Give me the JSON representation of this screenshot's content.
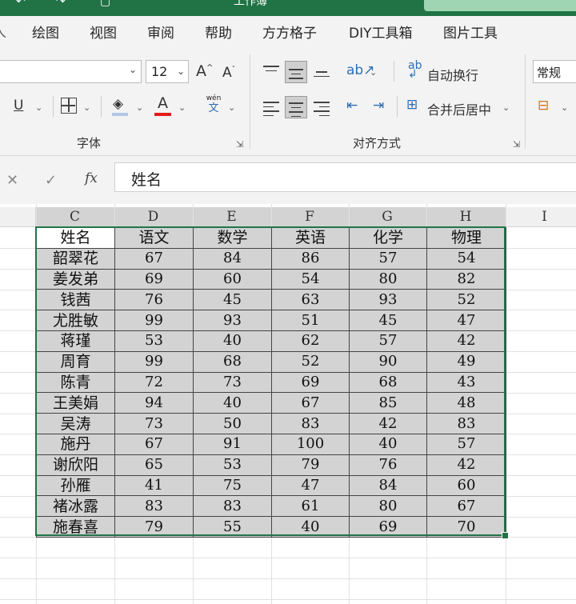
{
  "title_bar": {
    "title": "工作簿",
    "accent": "#217346"
  },
  "ribbon_tabs": [
    "绘图",
    "视图",
    "审阅",
    "帮助",
    "方方格子",
    "DIY工具箱",
    "图片工具"
  ],
  "font_group": {
    "font_name": "",
    "font_size": "12",
    "grow_font": "A",
    "shrink_font": "A",
    "underline": "U",
    "font_color_letter": "A",
    "phonetic": "wén",
    "phonetic_base": "文",
    "label": "字体"
  },
  "alignment_group": {
    "wrap_text": "自动换行",
    "merge_center": "合并后居中",
    "label": "对齐方式"
  },
  "number_group": {
    "format": "常规"
  },
  "formula_bar": {
    "cancel": "✕",
    "enter": "✓",
    "fx": "fx",
    "content": "姓名"
  },
  "columns": [
    "C",
    "D",
    "E",
    "F",
    "G",
    "H",
    "I"
  ],
  "table": {
    "headers": [
      "姓名",
      "语文",
      "数学",
      "英语",
      "化学",
      "物理"
    ],
    "rows": [
      [
        "韶翠花",
        "67",
        "84",
        "86",
        "57",
        "54"
      ],
      [
        "姜发弟",
        "69",
        "60",
        "54",
        "80",
        "82"
      ],
      [
        "钱茜",
        "76",
        "45",
        "63",
        "93",
        "52"
      ],
      [
        "尤胜敏",
        "99",
        "93",
        "51",
        "45",
        "47"
      ],
      [
        "蒋瑾",
        "53",
        "40",
        "62",
        "57",
        "42"
      ],
      [
        "周育",
        "99",
        "68",
        "52",
        "90",
        "49"
      ],
      [
        "陈青",
        "72",
        "73",
        "69",
        "68",
        "43"
      ],
      [
        "王美娟",
        "94",
        "40",
        "67",
        "85",
        "48"
      ],
      [
        "吴涛",
        "73",
        "50",
        "83",
        "42",
        "83"
      ],
      [
        "施丹",
        "67",
        "91",
        "100",
        "40",
        "57"
      ],
      [
        "谢欣阳",
        "65",
        "53",
        "79",
        "76",
        "42"
      ],
      [
        "孙雁",
        "41",
        "75",
        "47",
        "84",
        "60"
      ],
      [
        "褚冰露",
        "83",
        "83",
        "61",
        "80",
        "67"
      ],
      [
        "施春喜",
        "79",
        "55",
        "40",
        "69",
        "70"
      ]
    ]
  }
}
